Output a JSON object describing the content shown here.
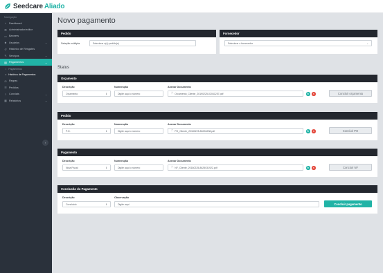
{
  "brand": {
    "name": "Seedcare",
    "accent": "Aliado",
    "color": "#21b3a6"
  },
  "sidebar": {
    "heading": "Navegação",
    "items": [
      {
        "label": "Dashboard",
        "icon": "home-icon"
      },
      {
        "label": "Administrador/editor",
        "icon": "key-icon"
      },
      {
        "label": "Banners",
        "icon": "image-icon"
      },
      {
        "label": "Usuários",
        "icon": "users-icon",
        "chevron": true
      },
      {
        "label": "Histórico de Resgates",
        "icon": "history-icon"
      },
      {
        "label": "Serviços",
        "icon": "wrench-icon",
        "chevron": true
      },
      {
        "label": "Pagamentos",
        "icon": "card-icon",
        "chevron": true,
        "active": true
      }
    ],
    "subitems": [
      {
        "label": "Pagamentos"
      },
      {
        "label": "Histórico de Pagamentos",
        "current": true
      }
    ],
    "items_after": [
      {
        "label": "Regras",
        "icon": "gavel-icon"
      },
      {
        "label": "Pedidos",
        "icon": "list-icon"
      },
      {
        "label": "Conviats",
        "icon": "question-icon",
        "chevron": true
      },
      {
        "label": "Relatórios",
        "icon": "report-icon",
        "chevron": true
      }
    ],
    "collapse_icon": "chevron-left-icon"
  },
  "page": {
    "title": "Novo pagamento",
    "status_title": "Status"
  },
  "pedido_filter": {
    "header": "Pedido",
    "label": "Seleção múltipla",
    "placeholder": "Selecione o(s) pedido(s)"
  },
  "fornecedor": {
    "header": "Fornecedor",
    "placeholder": "Selecione o fornecedor"
  },
  "sections": [
    {
      "header": "Orçamento",
      "desc_label": "Descrição",
      "num_label": "Numeração",
      "doc_label": "Anexar Documento",
      "desc_value": "Orçamento",
      "num_placeholder": "Digite aqui o número",
      "file": "Orcamento_Cliente_20190225-02041257.pdf",
      "button": "Concluir orçamento"
    },
    {
      "header": "Pedido",
      "desc_label": "Descrição",
      "num_label": "Numeração",
      "doc_label": "Anexar Documento",
      "desc_value": "P.O.",
      "num_placeholder": "Digite aqui o número",
      "file": "PO_Cliente_20180225-56094238.pdf",
      "button": "Concluir PO"
    },
    {
      "header": "Pagamento",
      "desc_label": "Descrição",
      "num_label": "Numeração",
      "doc_label": "Anexar Documento",
      "desc_value": "Nota Fiscal",
      "num_placeholder": "Digite aqui o número",
      "file": "NF_Cliente_20180225-8625031922.pdf",
      "button": "Concluir NF"
    }
  ],
  "conclusao": {
    "header": "Conclusão do Pagamento",
    "desc_label": "Descrição",
    "obs_label": "Observação",
    "desc_value": "Concluido",
    "obs_placeholder": "Digite aqui",
    "button": "Concluir pagamento"
  }
}
